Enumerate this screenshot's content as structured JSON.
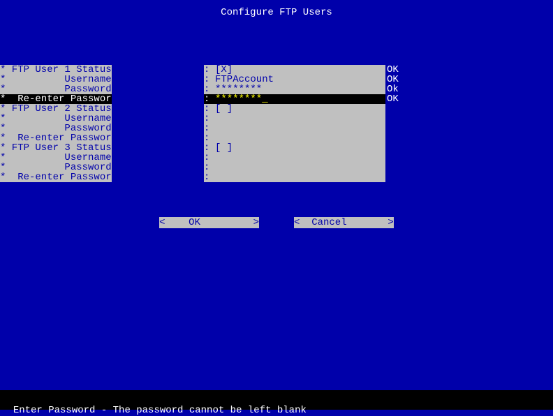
{
  "header": {
    "title": "Configure FTP Users"
  },
  "rows": [
    {
      "label": "* FTP User 1 Status   ",
      "value": "[X]",
      "status": "OK",
      "highlighted": false
    },
    {
      "label": "*          Username   ",
      "value": "FTPAccount",
      "status": "OK",
      "highlighted": false
    },
    {
      "label": "*          Password   ",
      "value": "********",
      "status": "Ok",
      "highlighted": false
    },
    {
      "label": "*  Re-enter Password  ",
      "value": "********_",
      "status": "OK",
      "highlighted": true
    },
    {
      "label": "* FTP User 2 Status   ",
      "value": "[ ]",
      "status": "",
      "highlighted": false
    },
    {
      "label": "*          Username   ",
      "value": "",
      "status": "",
      "highlighted": false
    },
    {
      "label": "*          Password   ",
      "value": "",
      "status": "",
      "highlighted": false
    },
    {
      "label": "*  Re-enter Password  ",
      "value": "",
      "status": "",
      "highlighted": false
    },
    {
      "label": "* FTP User 3 Status   ",
      "value": "[ ]",
      "status": "",
      "highlighted": false
    },
    {
      "label": "*          Username   ",
      "value": "",
      "status": "",
      "highlighted": false
    },
    {
      "label": "*          Password   ",
      "value": "",
      "status": "",
      "highlighted": false
    },
    {
      "label": "*  Re-enter Password  ",
      "value": "",
      "status": "",
      "highlighted": false
    }
  ],
  "buttons": {
    "ok": "<    OK         >",
    "cancel": "<  Cancel       >"
  },
  "footer": {
    "text": "Enter Password - The password cannot be left blank"
  }
}
